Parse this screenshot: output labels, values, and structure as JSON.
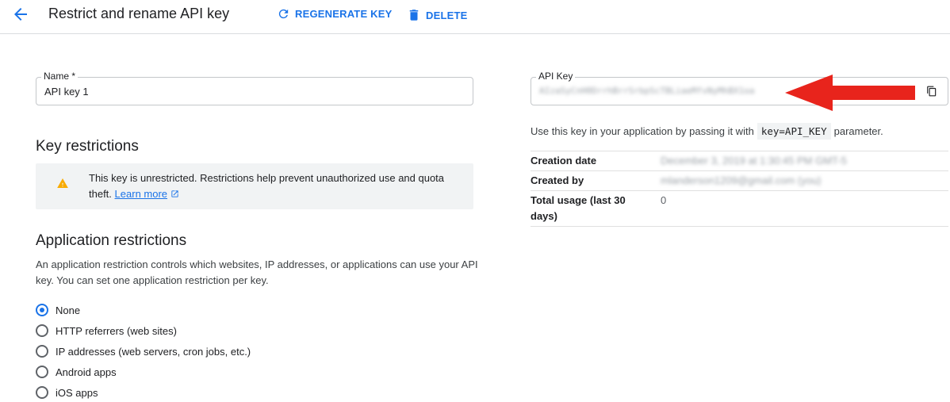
{
  "header": {
    "title": "Restrict and rename API key",
    "regenerate_label": "REGENERATE KEY",
    "delete_label": "DELETE"
  },
  "name_field": {
    "label": "Name *",
    "value": "API key 1"
  },
  "key_restrictions": {
    "heading": "Key restrictions",
    "warning_text": "This key is unrestricted. Restrictions help prevent unauthorized use and quota theft.",
    "learn_more": "Learn more"
  },
  "app_restrictions": {
    "heading": "Application restrictions",
    "description": "An application restriction controls which websites, IP addresses, or applications can use your API key. You can set one application restriction per key.",
    "options": [
      {
        "label": "None",
        "selected": true
      },
      {
        "label": "HTTP referrers (web sites)",
        "selected": false
      },
      {
        "label": "IP addresses (web servers, cron jobs, etc.)",
        "selected": false
      },
      {
        "label": "Android apps",
        "selected": false
      },
      {
        "label": "iOS apps",
        "selected": false
      }
    ]
  },
  "api_key": {
    "label": "API Key",
    "value": "AIzaSyCnH0DrrhBrrSrbpScTBLiaeMfvNyMhBX1oa",
    "use_prefix": "Use this key in your application by passing it with",
    "use_code": "key=API_KEY",
    "use_suffix": "parameter."
  },
  "info": {
    "creation_label": "Creation date",
    "creation_value": "December 3, 2019 at 1:30:45 PM GMT-5",
    "created_by_label": "Created by",
    "created_by_value": "mlanderson1209@gmail.com (you)",
    "usage_label": "Total usage (last 30 days)",
    "usage_value": "0"
  },
  "colors": {
    "accent": "#1a73e8",
    "warning": "#f9ab00",
    "arrow": "#e8241c"
  }
}
